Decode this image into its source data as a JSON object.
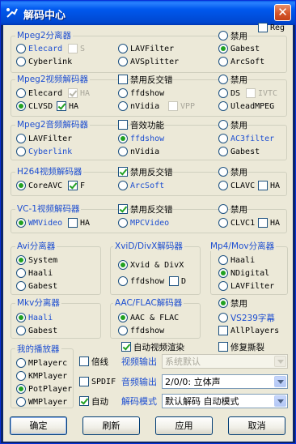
{
  "window": {
    "title": "解码中心",
    "close_label": "✕"
  },
  "reg": {
    "label": "Reg",
    "checked": false
  },
  "mpeg2_splitter": {
    "title": "Mpeg2分离器",
    "disable": {
      "label": "禁用",
      "on": false
    },
    "options": [
      "Elecard",
      "LAVFilter",
      "Gabest",
      "Cyberlink",
      "AVSplitter",
      "ArcSoft"
    ],
    "selected": "Gabest",
    "s_label": "S"
  },
  "mpeg2_video": {
    "title": "Mpeg2视频解码器",
    "disable": {
      "label": "禁用",
      "on": false
    },
    "deinterlace": "禁用反交错",
    "options": [
      "Elecard",
      "ffdshow",
      "DS",
      "CLVSD",
      "nVidia",
      "UleadMPEG"
    ],
    "selected": "CLVSD",
    "ha_elecard": "HA",
    "ha_clvsd": "HA",
    "ivtc": "IVTC",
    "vpp": "VPP"
  },
  "mpeg2_audio": {
    "title": "Mpeg2音频解码器",
    "disable": {
      "label": "禁用",
      "on": false
    },
    "effect": "音效功能",
    "options": [
      "LAVFilter",
      "ffdshow",
      "AC3filter",
      "Cyberlink",
      "nVidia",
      "Gabest"
    ],
    "selected": "ffdshow"
  },
  "h264": {
    "title": "H264视频解码器",
    "disable": {
      "label": "禁用",
      "on": false
    },
    "deinterlace": "禁用反交错",
    "options": [
      "CoreAVC",
      "ArcSoft",
      "CLAVC"
    ],
    "selected": "CoreAVC",
    "f_label": "F",
    "ha_label": "HA"
  },
  "vc1": {
    "title": "VC-1视频解码器",
    "disable": {
      "label": "禁用",
      "on": false
    },
    "deinterlace": "禁用反交错",
    "options": [
      "WMVideo",
      "MPCVideo",
      "CLVC1"
    ],
    "selected": "WMVideo",
    "ha_wm": "HA",
    "ha_clvc1": "HA"
  },
  "avi": {
    "title": "Avi分离器",
    "options": [
      "System",
      "Haali",
      "Gabest"
    ],
    "selected": "System"
  },
  "xvid": {
    "title": "XviD/DivX解码器",
    "options": [
      "Xvid & DivX",
      "ffdshow"
    ],
    "selected": "Xvid & DivX",
    "d_label": "D"
  },
  "mp4": {
    "title": "Mp4/Mov分离器",
    "options": [
      "Haali",
      "NDigital",
      "LAVFilter"
    ],
    "selected": "NDigital"
  },
  "mkv": {
    "title": "Mkv分离器",
    "options": [
      "Haali",
      "Gabest"
    ],
    "selected": "Haali"
  },
  "aac": {
    "title": "AAC/FLAC解码器",
    "options": [
      "AAC & FLAC",
      "ffdshow"
    ],
    "selected": "AAC & FLAC"
  },
  "misc": {
    "disable": "禁用",
    "vs239": "VS239字幕",
    "allplayers": "AllPlayers",
    "auto_render": "自动视频渲染",
    "repair_tear": "修复撕裂"
  },
  "players": {
    "title": "我的播放器",
    "options": [
      "MPlayerc",
      "KMPlayer",
      "PotPlayer",
      "WMPlayer"
    ],
    "selected": "PotPlayer"
  },
  "output": {
    "double_label": "倍线",
    "video_out_label": "视频输出",
    "video_out_value": "系统默认",
    "spdif_label": "SPDIF",
    "audio_out_label": "音频输出",
    "audio_out_value": "2/0/0: 立体声",
    "auto_label": "自动",
    "decode_mode_label": "解码模式",
    "decode_mode_value": "默认解码 自动模式"
  },
  "buttons": {
    "ok": "确定",
    "refresh": "刷新",
    "apply": "应用",
    "cancel": "取消"
  }
}
